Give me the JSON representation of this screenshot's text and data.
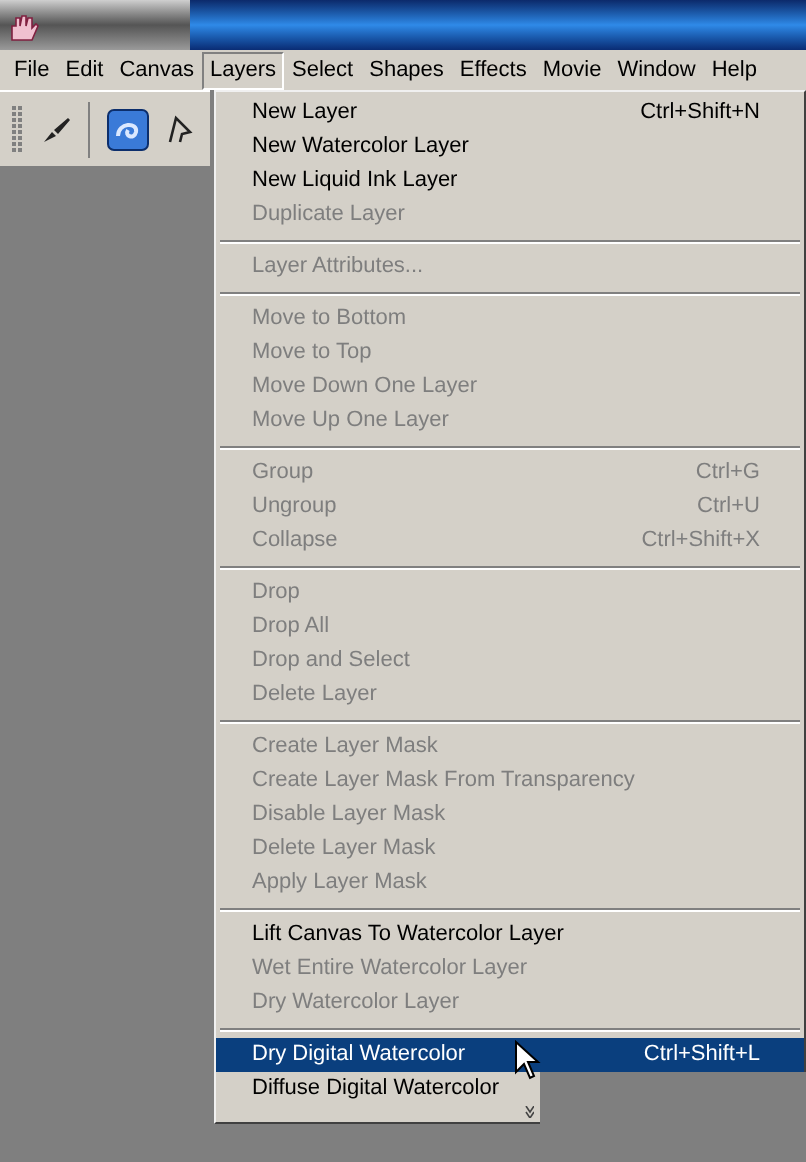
{
  "menu_bar": [
    {
      "label": "File",
      "selected": false
    },
    {
      "label": "Edit",
      "selected": false
    },
    {
      "label": "Canvas",
      "selected": false
    },
    {
      "label": "Layers",
      "selected": true
    },
    {
      "label": "Select",
      "selected": false
    },
    {
      "label": "Shapes",
      "selected": false
    },
    {
      "label": "Effects",
      "selected": false
    },
    {
      "label": "Movie",
      "selected": false
    },
    {
      "label": "Window",
      "selected": false
    },
    {
      "label": "Help",
      "selected": false
    }
  ],
  "menu": {
    "sections": [
      [
        {
          "label": "New Layer",
          "shortcut": "Ctrl+Shift+N",
          "disabled": false,
          "selected": false
        },
        {
          "label": "New Watercolor Layer",
          "disabled": false,
          "selected": false
        },
        {
          "label": "New Liquid Ink Layer",
          "disabled": false,
          "selected": false
        },
        {
          "label": "Duplicate Layer",
          "disabled": true,
          "selected": false
        }
      ],
      [
        {
          "label": "Layer Attributes...",
          "disabled": true,
          "selected": false
        }
      ],
      [
        {
          "label": "Move to Bottom",
          "disabled": true,
          "selected": false
        },
        {
          "label": "Move to Top",
          "disabled": true,
          "selected": false
        },
        {
          "label": "Move Down One Layer",
          "disabled": true,
          "selected": false
        },
        {
          "label": "Move Up One Layer",
          "disabled": true,
          "selected": false
        }
      ],
      [
        {
          "label": "Group",
          "shortcut": "Ctrl+G",
          "disabled": true,
          "selected": false
        },
        {
          "label": "Ungroup",
          "shortcut": "Ctrl+U",
          "disabled": true,
          "selected": false
        },
        {
          "label": "Collapse",
          "shortcut": "Ctrl+Shift+X",
          "disabled": true,
          "selected": false
        }
      ],
      [
        {
          "label": "Drop",
          "disabled": true,
          "selected": false
        },
        {
          "label": "Drop All",
          "disabled": true,
          "selected": false
        },
        {
          "label": "Drop and Select",
          "disabled": true,
          "selected": false
        },
        {
          "label": "Delete Layer",
          "disabled": true,
          "selected": false
        }
      ],
      [
        {
          "label": "Create Layer Mask",
          "disabled": true,
          "selected": false
        },
        {
          "label": "Create Layer Mask From Transparency",
          "disabled": true,
          "selected": false
        },
        {
          "label": "Disable Layer Mask",
          "disabled": true,
          "selected": false
        },
        {
          "label": "Delete Layer Mask",
          "disabled": true,
          "selected": false
        },
        {
          "label": "Apply Layer Mask",
          "disabled": true,
          "selected": false
        }
      ],
      [
        {
          "label": "Lift Canvas To Watercolor Layer",
          "disabled": false,
          "selected": false
        },
        {
          "label": "Wet Entire Watercolor Layer",
          "disabled": true,
          "selected": false
        },
        {
          "label": "Dry Watercolor Layer",
          "disabled": true,
          "selected": false
        }
      ],
      [
        {
          "label": "Dry Digital Watercolor",
          "shortcut": "Ctrl+Shift+L",
          "disabled": false,
          "selected": true
        },
        {
          "label": "Diffuse Digital Watercolor",
          "disabled": false,
          "selected": false
        }
      ]
    ]
  }
}
